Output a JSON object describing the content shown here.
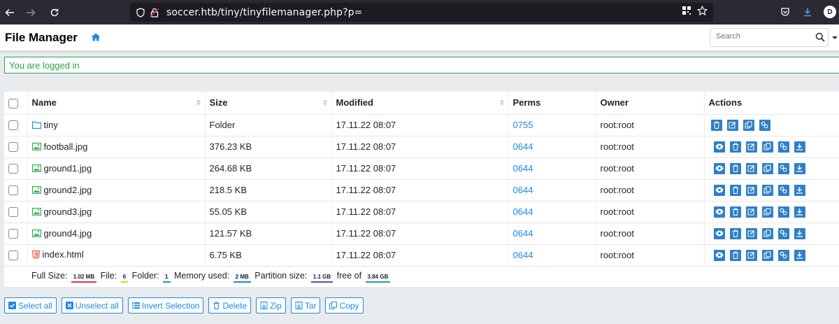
{
  "browser": {
    "url": "soccer.htb/tiny/tinyfilemanager.php?p=",
    "profile_initial": "D"
  },
  "app": {
    "brand": "File Manager",
    "search_placeholder": "Search",
    "alert": "You are logged in",
    "accent_color": "#1e88e5",
    "success_color": "#28a745"
  },
  "table": {
    "headers": {
      "name": "Name",
      "size": "Size",
      "modified": "Modified",
      "perms": "Perms",
      "owner": "Owner",
      "actions": "Actions"
    },
    "rows": [
      {
        "name": "tiny",
        "type": "folder",
        "size": "Folder",
        "modified": "17.11.22 08:07",
        "perms": "0755",
        "owner": "root:root"
      },
      {
        "name": "football.jpg",
        "type": "image",
        "size": "376.23 KB",
        "modified": "17.11.22 08:07",
        "perms": "0644",
        "owner": "root:root"
      },
      {
        "name": "ground1.jpg",
        "type": "image",
        "size": "264.68 KB",
        "modified": "17.11.22 08:07",
        "perms": "0644",
        "owner": "root:root"
      },
      {
        "name": "ground2.jpg",
        "type": "image",
        "size": "218.5 KB",
        "modified": "17.11.22 08:07",
        "perms": "0644",
        "owner": "root:root"
      },
      {
        "name": "ground3.jpg",
        "type": "image",
        "size": "55.05 KB",
        "modified": "17.11.22 08:07",
        "perms": "0644",
        "owner": "root:root"
      },
      {
        "name": "ground4.jpg",
        "type": "image",
        "size": "121.57 KB",
        "modified": "17.11.22 08:07",
        "perms": "0644",
        "owner": "root:root"
      },
      {
        "name": "index.html",
        "type": "html",
        "size": "6.75 KB",
        "modified": "17.11.22 08:07",
        "perms": "0644",
        "owner": "root:root"
      }
    ],
    "footer": {
      "full_size_label": "Full Size:",
      "full_size": "1.02 MB",
      "file_label": "File:",
      "file_count": "6",
      "folder_label": "Folder:",
      "folder_count": "1",
      "memory_label": "Memory used:",
      "memory": "2 MB",
      "partition_label": "Partition size:",
      "partition": "1.1 GB",
      "free_label": "free of",
      "free": "3.84 GB"
    }
  },
  "buttons": {
    "select_all": "Select all",
    "unselect_all": "Unselect all",
    "invert_selection": "Invert Selection",
    "delete": "Delete",
    "zip": "Zip",
    "tar": "Tar",
    "copy": "Copy"
  }
}
